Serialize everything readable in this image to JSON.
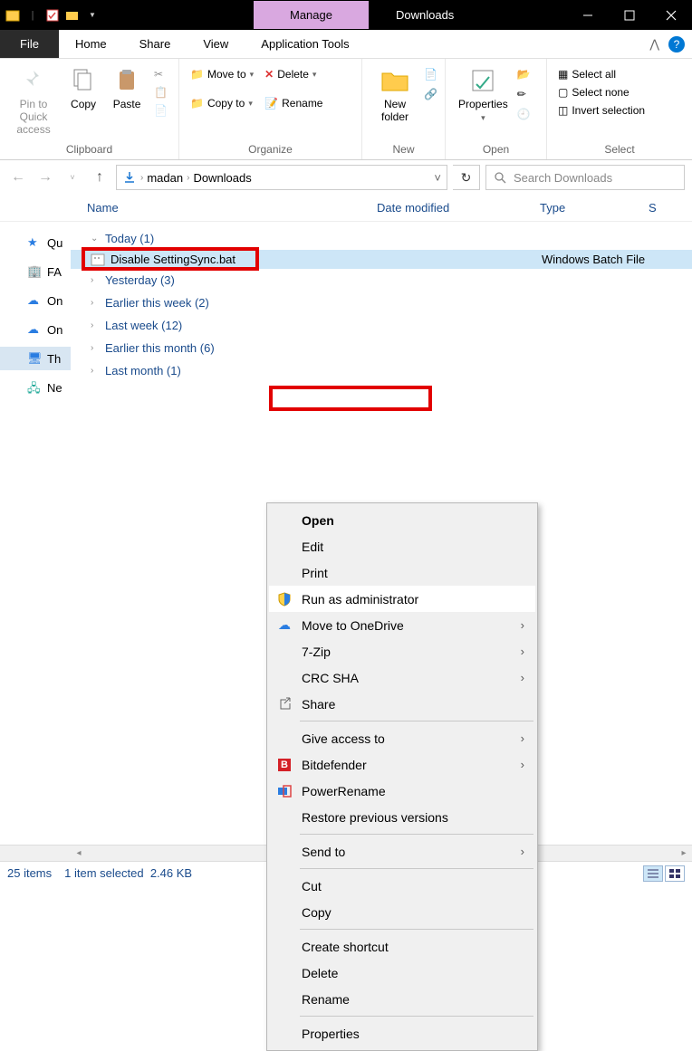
{
  "titlebar": {
    "context_tab": "Manage",
    "title": "Downloads"
  },
  "ribbon_tabs": {
    "file": "File",
    "home": "Home",
    "share": "Share",
    "view": "View",
    "app_tools": "Application Tools"
  },
  "ribbon": {
    "clipboard": {
      "label": "Clipboard",
      "pin": "Pin to Quick access",
      "copy": "Copy",
      "paste": "Paste"
    },
    "organize": {
      "label": "Organize",
      "move_to": "Move to",
      "copy_to": "Copy to",
      "delete": "Delete",
      "rename": "Rename"
    },
    "new": {
      "label": "New",
      "new_folder": "New folder"
    },
    "open": {
      "label": "Open",
      "properties": "Properties"
    },
    "select": {
      "label": "Select",
      "all": "Select all",
      "none": "Select none",
      "invert": "Invert selection"
    }
  },
  "breadcrumb": {
    "seg1": "madan",
    "seg2": "Downloads"
  },
  "search": {
    "placeholder": "Search Downloads"
  },
  "columns": {
    "name": "Name",
    "date": "Date modified",
    "type": "Type",
    "s": "S"
  },
  "nav": {
    "quick": "Qu",
    "fa": "FA",
    "on1": "On",
    "on2": "On",
    "th": "Th",
    "ne": "Ne"
  },
  "groups": {
    "today": "Today (1)",
    "yesterday": "Yesterday (3)",
    "this_week": "Earlier this week (2)",
    "last_week": "Last week (12)",
    "this_month": "Earlier this month (6)",
    "last_month": "Last month (1)"
  },
  "file": {
    "name": "Disable SettingSync.bat",
    "type": "Windows Batch File"
  },
  "context_menu": {
    "open": "Open",
    "edit": "Edit",
    "print": "Print",
    "run_admin": "Run as administrator",
    "onedrive": "Move to OneDrive",
    "sevenzip": "7-Zip",
    "crc": "CRC SHA",
    "share": "Share",
    "give_access": "Give access to",
    "bitdefender": "Bitdefender",
    "powerrename": "PowerRename",
    "restore": "Restore previous versions",
    "send_to": "Send to",
    "cut": "Cut",
    "copy": "Copy",
    "shortcut": "Create shortcut",
    "delete": "Delete",
    "rename": "Rename",
    "properties": "Properties"
  },
  "status": {
    "items": "25 items",
    "selected": "1 item selected",
    "size": "2.46 KB"
  }
}
